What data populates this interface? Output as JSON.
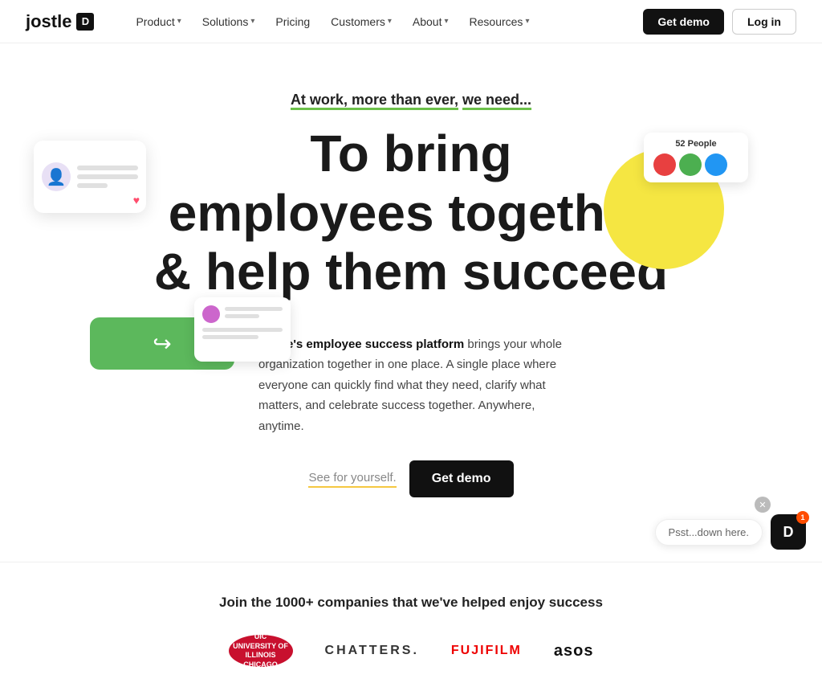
{
  "nav": {
    "logo_text": "jostle",
    "items": [
      {
        "label": "Product",
        "has_dropdown": true
      },
      {
        "label": "Solutions",
        "has_dropdown": true
      },
      {
        "label": "Pricing",
        "has_dropdown": false
      },
      {
        "label": "Customers",
        "has_dropdown": true
      },
      {
        "label": "About",
        "has_dropdown": true
      },
      {
        "label": "Resources",
        "has_dropdown": true
      }
    ],
    "cta_demo": "Get demo",
    "cta_login": "Log in"
  },
  "hero": {
    "tagline_plain": "At work, more than ever,",
    "tagline_highlight": "we need...",
    "heading_line1": "To bring",
    "heading_line2": "employees together",
    "heading_line3": "& help them succeed",
    "people_count": "52 People",
    "description_bold": "Jostle's employee success platform",
    "description_rest": " brings your whole organization together in one place. A single place where everyone can quickly find what they need, clarify what matters, and celebrate success together. Anywhere, anytime.",
    "link_see": "See for yourself.",
    "cta_demo": "Get demo"
  },
  "social_proof": {
    "heading": "Join the 1000+ companies that we've helped enjoy success",
    "logos": [
      {
        "name": "University of Illinois Chicago",
        "short": "UIC\nUniversity of\nIllinois Chicago"
      },
      {
        "name": "Chatters",
        "display": "CHATTERS."
      },
      {
        "name": "Fujifilm",
        "display": "FUJIFILM"
      },
      {
        "name": "ASOS",
        "display": "asos"
      }
    ]
  },
  "chat": {
    "bubble_text": "Psst...down here.",
    "badge_count": "1"
  }
}
